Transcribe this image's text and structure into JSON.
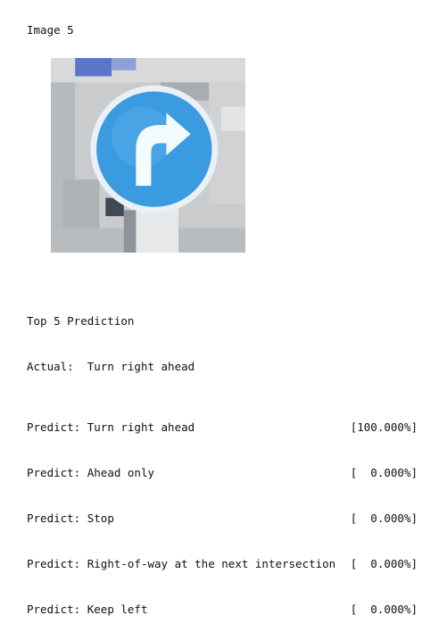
{
  "image_title": "Image 5",
  "image": {
    "alt": "",
    "colors": {
      "sign_blue": "#3a9be0",
      "sign_border": "#e8eef6",
      "arrow_white": "#ffffff",
      "bg_gray": "#c8cacc",
      "pole_dark": "#3e4a56",
      "top_blue": "#5b76c8"
    }
  },
  "output": {
    "heading": "Top 5 Prediction",
    "actual_label": "Actual:",
    "actual_value": "Turn right ahead",
    "predictions": [
      {
        "label": "Predict:",
        "name": "Turn right ahead",
        "prob": "[100.000%]"
      },
      {
        "label": "Predict:",
        "name": "Ahead only",
        "prob": "[  0.000%]"
      },
      {
        "label": "Predict:",
        "name": "Stop",
        "prob": "[  0.000%]"
      },
      {
        "label": "Predict:",
        "name": "Right-of-way at the next intersection",
        "prob": "[  0.000%]"
      },
      {
        "label": "Predict:",
        "name": "Keep left",
        "prob": "[  0.000%]"
      }
    ]
  }
}
